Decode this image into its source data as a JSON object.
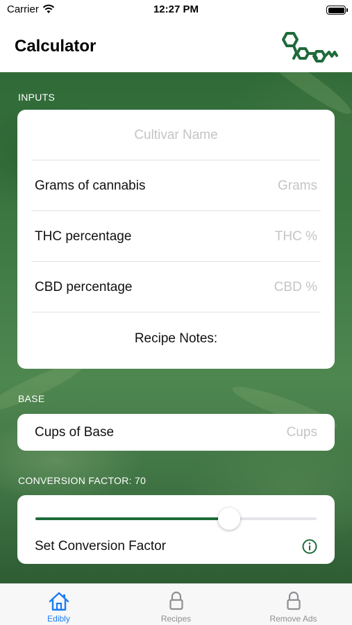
{
  "status_bar": {
    "carrier": "Carrier",
    "time": "12:27 PM"
  },
  "nav": {
    "title": "Calculator",
    "logo": "molecule-logo"
  },
  "inputs": {
    "header": "INPUTS",
    "cultivar_placeholder": "Cultivar Name",
    "rows": [
      {
        "label": "Grams of cannabis",
        "placeholder": "Grams"
      },
      {
        "label": "THC percentage",
        "placeholder": "THC %"
      },
      {
        "label": "CBD percentage",
        "placeholder": "CBD %"
      }
    ],
    "notes_label": "Recipe Notes:"
  },
  "base": {
    "header": "BASE",
    "label": "Cups of Base",
    "placeholder": "Cups"
  },
  "conversion": {
    "header": "CONVERSION FACTOR: 70",
    "value": 70,
    "slider_fraction": 0.69,
    "label": "Set Conversion Factor",
    "info_icon": "info-icon"
  },
  "tabs": [
    {
      "label": "Edibly",
      "icon": "home-icon",
      "active": true
    },
    {
      "label": "Recipes",
      "icon": "lock-icon",
      "active": false
    },
    {
      "label": "Remove Ads",
      "icon": "lock-icon",
      "active": false
    }
  ],
  "colors": {
    "accent_green": "#1e6b3a",
    "tab_active": "#1a7cf5",
    "tab_inactive": "#8e8e93"
  }
}
